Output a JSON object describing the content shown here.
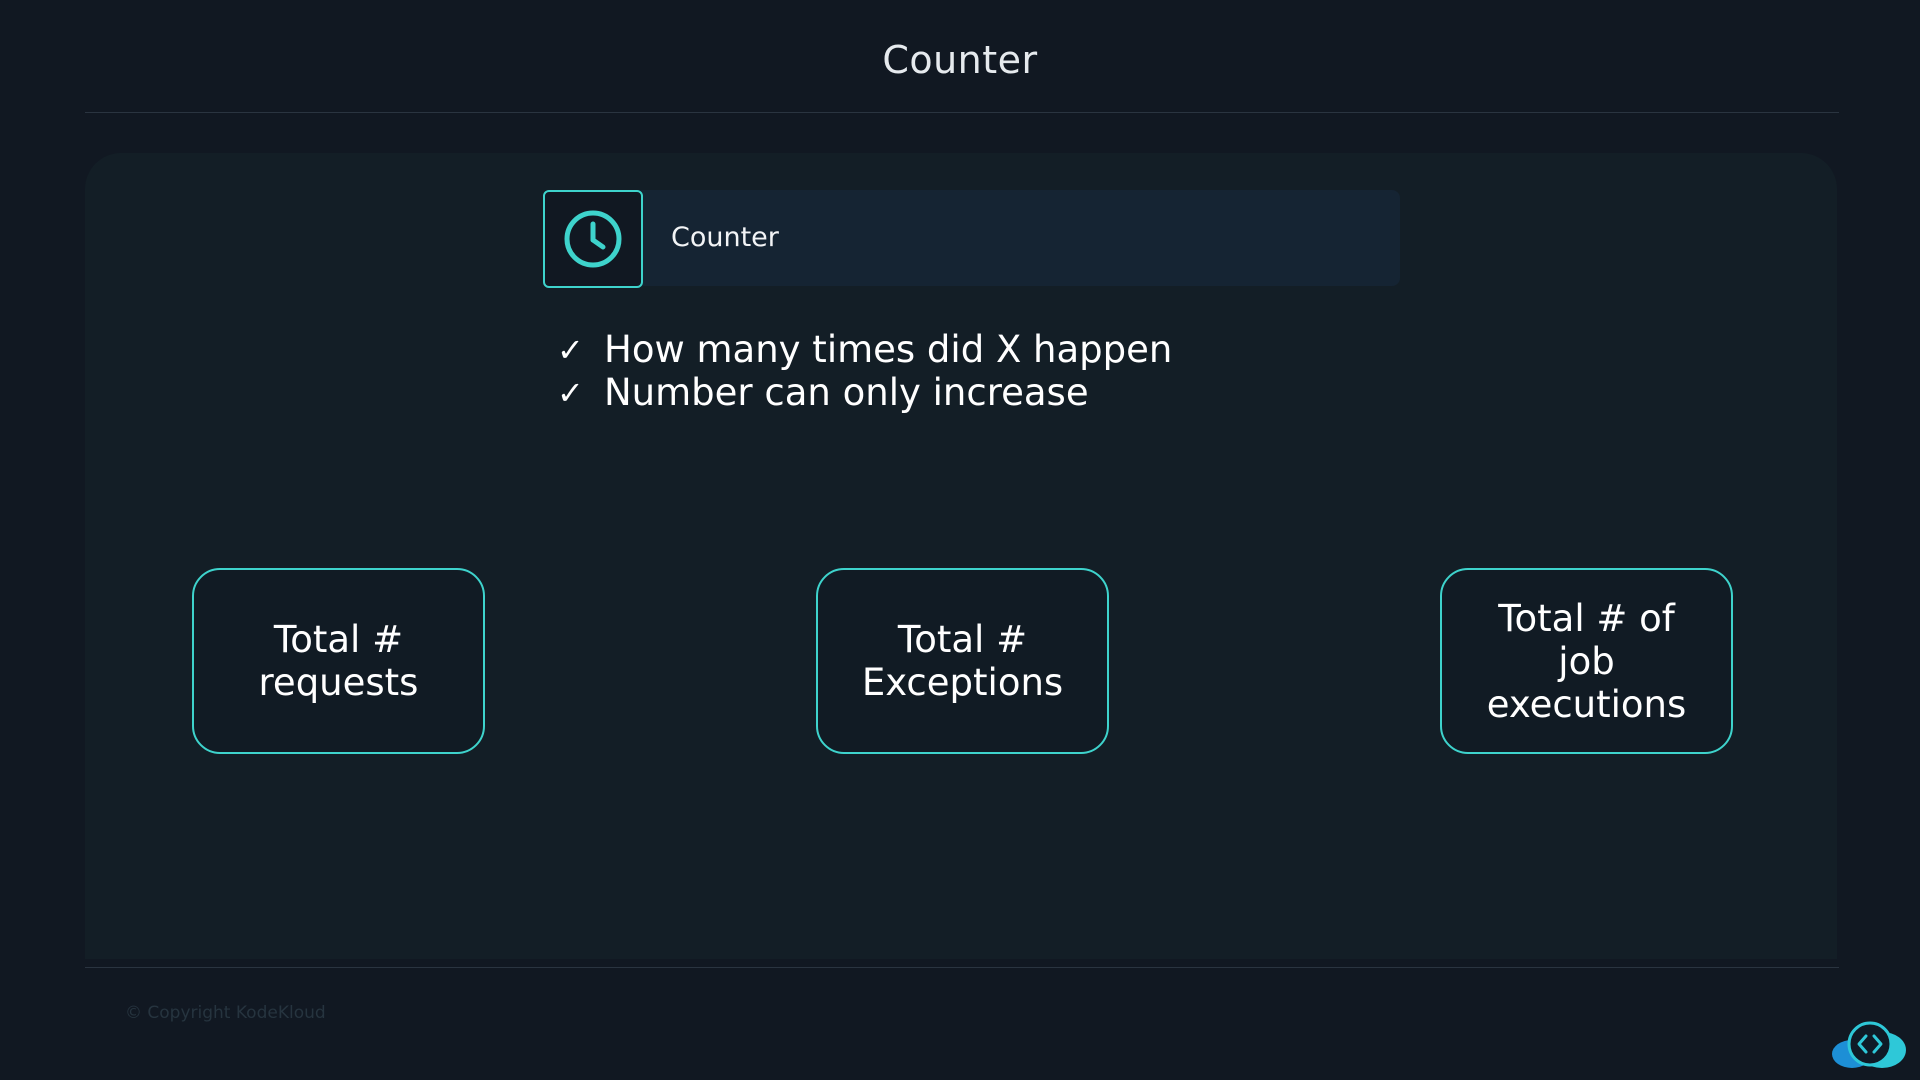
{
  "slide": {
    "title": "Counter"
  },
  "header": {
    "label": "Counter",
    "icon": "clock-icon"
  },
  "bullets": [
    {
      "mark": "✓",
      "text": "How many times did X happen"
    },
    {
      "mark": "✓",
      "text": "Number can only increase"
    }
  ],
  "cards": [
    {
      "text": "Total # requests"
    },
    {
      "text": "Total # Exceptions"
    },
    {
      "text": "Total # of job executions"
    }
  ],
  "footer": {
    "copyright": "© Copyright KodeKloud",
    "logo_icon": "kodekloud-logo-icon"
  },
  "colors": {
    "accent": "#3ed3cc",
    "background": "#111822",
    "panel": "#131e26",
    "header_bar": "#152433"
  }
}
